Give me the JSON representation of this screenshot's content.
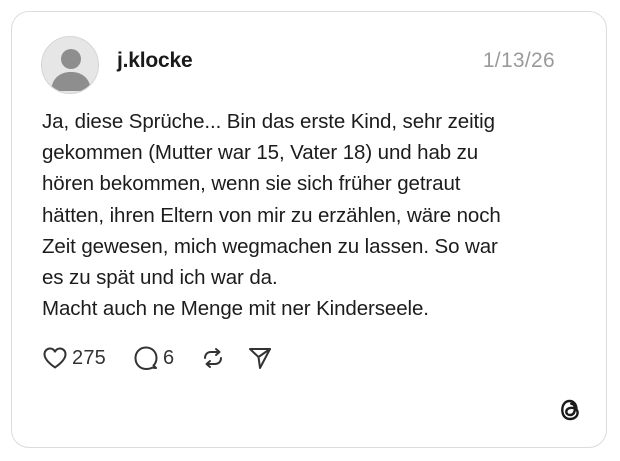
{
  "post": {
    "username": "j.klocke",
    "date": "1/13/26",
    "lines": [
      "Ja, diese Sprüche... Bin das erste Kind, sehr zeitig",
      "gekommen (Mutter war 15, Vater 18) und hab zu",
      "hören bekommen, wenn sie sich früher getraut",
      "hätten, ihren Eltern von mir zu erzählen, wäre noch",
      "Zeit gewesen, mich wegmachen zu lassen. So war",
      "es zu spät und ich war da.",
      "Macht auch ne Menge mit ner Kinderseele."
    ]
  },
  "actions": {
    "likes": "275",
    "replies": "6"
  },
  "icons": {
    "avatar": "default-avatar-icon",
    "like": "heart-icon",
    "reply": "comment-bubble-icon",
    "repost": "repost-icon",
    "share": "send-icon",
    "brand": "threads-logo-icon"
  },
  "colors": {
    "card_border": "#dcdcdc",
    "text": "#1c1c1c",
    "muted": "#9a9a9a",
    "avatar_bg": "#e6e6e6",
    "avatar_glyph": "#8e8e8e"
  }
}
